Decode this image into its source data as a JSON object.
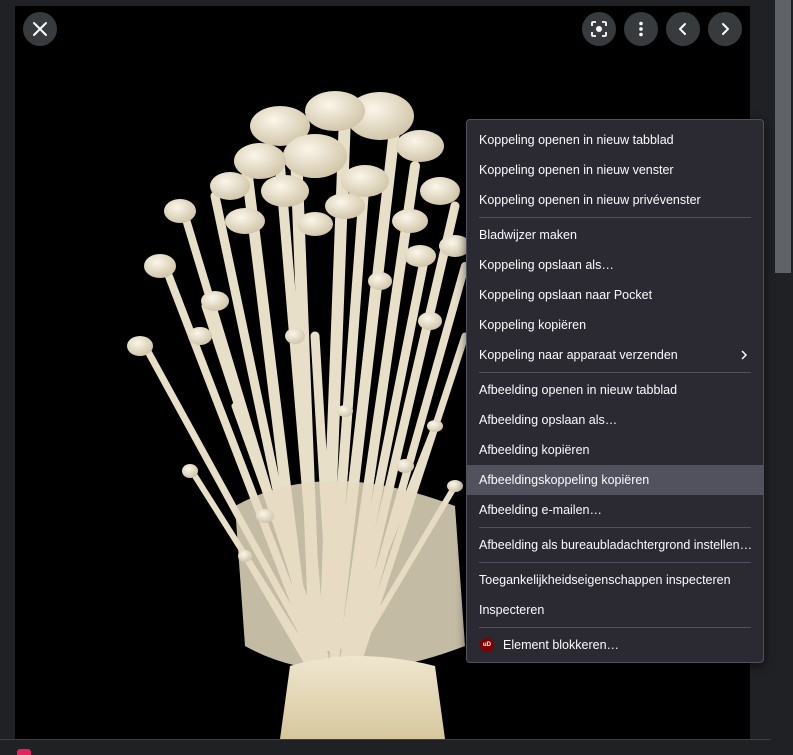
{
  "colors": {
    "page_bg": "#202124",
    "viewer_bg": "#000000",
    "menu_bg": "#2b2a33",
    "menu_hover": "#52525e",
    "menu_text": "#fbfbfe",
    "ublock_red": "#800000"
  },
  "toolbar": {
    "close_icon": "close-icon",
    "lens_icon": "lens-icon",
    "more_icon": "more-vert-icon",
    "prev_icon": "chevron-left-icon",
    "next_icon": "chevron-right-icon"
  },
  "image": {
    "subject": "enoki-mushrooms-photo"
  },
  "context_menu": {
    "items": [
      {
        "label": "Koppeling openen in nieuw tabblad"
      },
      {
        "label": "Koppeling openen in nieuw venster"
      },
      {
        "label": "Koppeling openen in nieuw privévenster"
      },
      {
        "label": "Bladwijzer maken"
      },
      {
        "label": "Koppeling opslaan als…"
      },
      {
        "label": "Koppeling opslaan naar Pocket"
      },
      {
        "label": "Koppeling kopiëren"
      },
      {
        "label": "Koppeling naar apparaat verzenden",
        "submenu": true
      },
      {
        "label": "Afbeelding openen in nieuw tabblad"
      },
      {
        "label": "Afbeelding opslaan als…"
      },
      {
        "label": "Afbeelding kopiëren"
      },
      {
        "label": "Afbeeldingskoppeling kopiëren",
        "highlighted": true
      },
      {
        "label": "Afbeelding e-mailen…"
      },
      {
        "label": "Afbeelding als bureaubladachtergrond instellen…"
      },
      {
        "label": "Toegankelijkheidseigenschappen inspecteren"
      },
      {
        "label": "Inspecteren"
      },
      {
        "label": "Element blokkeren…",
        "icon": "ublock-origin-icon",
        "icon_text": "uD"
      }
    ]
  }
}
